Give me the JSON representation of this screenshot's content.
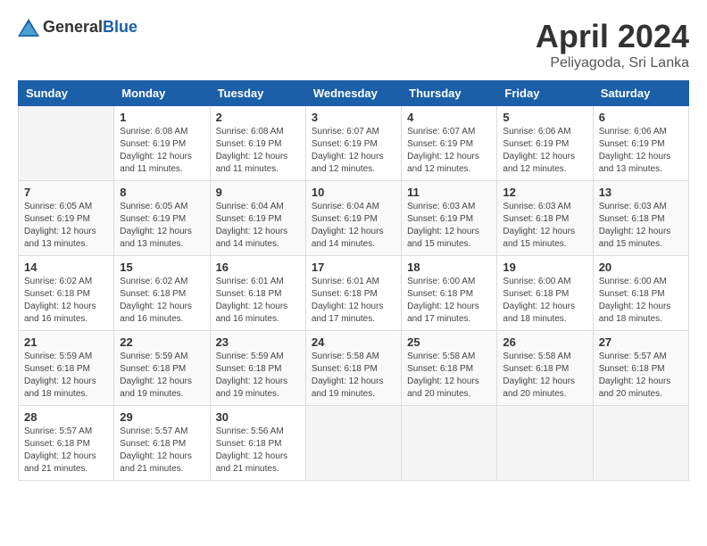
{
  "header": {
    "logo_general": "General",
    "logo_blue": "Blue",
    "month": "April 2024",
    "location": "Peliyagoda, Sri Lanka"
  },
  "weekdays": [
    "Sunday",
    "Monday",
    "Tuesday",
    "Wednesday",
    "Thursday",
    "Friday",
    "Saturday"
  ],
  "weeks": [
    [
      {
        "day": "",
        "sunrise": "",
        "sunset": "",
        "daylight": ""
      },
      {
        "day": "1",
        "sunrise": "Sunrise: 6:08 AM",
        "sunset": "Sunset: 6:19 PM",
        "daylight": "Daylight: 12 hours and 11 minutes."
      },
      {
        "day": "2",
        "sunrise": "Sunrise: 6:08 AM",
        "sunset": "Sunset: 6:19 PM",
        "daylight": "Daylight: 12 hours and 11 minutes."
      },
      {
        "day": "3",
        "sunrise": "Sunrise: 6:07 AM",
        "sunset": "Sunset: 6:19 PM",
        "daylight": "Daylight: 12 hours and 12 minutes."
      },
      {
        "day": "4",
        "sunrise": "Sunrise: 6:07 AM",
        "sunset": "Sunset: 6:19 PM",
        "daylight": "Daylight: 12 hours and 12 minutes."
      },
      {
        "day": "5",
        "sunrise": "Sunrise: 6:06 AM",
        "sunset": "Sunset: 6:19 PM",
        "daylight": "Daylight: 12 hours and 12 minutes."
      },
      {
        "day": "6",
        "sunrise": "Sunrise: 6:06 AM",
        "sunset": "Sunset: 6:19 PM",
        "daylight": "Daylight: 12 hours and 13 minutes."
      }
    ],
    [
      {
        "day": "7",
        "sunrise": "Sunrise: 6:05 AM",
        "sunset": "Sunset: 6:19 PM",
        "daylight": "Daylight: 12 hours and 13 minutes."
      },
      {
        "day": "8",
        "sunrise": "Sunrise: 6:05 AM",
        "sunset": "Sunset: 6:19 PM",
        "daylight": "Daylight: 12 hours and 13 minutes."
      },
      {
        "day": "9",
        "sunrise": "Sunrise: 6:04 AM",
        "sunset": "Sunset: 6:19 PM",
        "daylight": "Daylight: 12 hours and 14 minutes."
      },
      {
        "day": "10",
        "sunrise": "Sunrise: 6:04 AM",
        "sunset": "Sunset: 6:19 PM",
        "daylight": "Daylight: 12 hours and 14 minutes."
      },
      {
        "day": "11",
        "sunrise": "Sunrise: 6:03 AM",
        "sunset": "Sunset: 6:19 PM",
        "daylight": "Daylight: 12 hours and 15 minutes."
      },
      {
        "day": "12",
        "sunrise": "Sunrise: 6:03 AM",
        "sunset": "Sunset: 6:18 PM",
        "daylight": "Daylight: 12 hours and 15 minutes."
      },
      {
        "day": "13",
        "sunrise": "Sunrise: 6:03 AM",
        "sunset": "Sunset: 6:18 PM",
        "daylight": "Daylight: 12 hours and 15 minutes."
      }
    ],
    [
      {
        "day": "14",
        "sunrise": "Sunrise: 6:02 AM",
        "sunset": "Sunset: 6:18 PM",
        "daylight": "Daylight: 12 hours and 16 minutes."
      },
      {
        "day": "15",
        "sunrise": "Sunrise: 6:02 AM",
        "sunset": "Sunset: 6:18 PM",
        "daylight": "Daylight: 12 hours and 16 minutes."
      },
      {
        "day": "16",
        "sunrise": "Sunrise: 6:01 AM",
        "sunset": "Sunset: 6:18 PM",
        "daylight": "Daylight: 12 hours and 16 minutes."
      },
      {
        "day": "17",
        "sunrise": "Sunrise: 6:01 AM",
        "sunset": "Sunset: 6:18 PM",
        "daylight": "Daylight: 12 hours and 17 minutes."
      },
      {
        "day": "18",
        "sunrise": "Sunrise: 6:00 AM",
        "sunset": "Sunset: 6:18 PM",
        "daylight": "Daylight: 12 hours and 17 minutes."
      },
      {
        "day": "19",
        "sunrise": "Sunrise: 6:00 AM",
        "sunset": "Sunset: 6:18 PM",
        "daylight": "Daylight: 12 hours and 18 minutes."
      },
      {
        "day": "20",
        "sunrise": "Sunrise: 6:00 AM",
        "sunset": "Sunset: 6:18 PM",
        "daylight": "Daylight: 12 hours and 18 minutes."
      }
    ],
    [
      {
        "day": "21",
        "sunrise": "Sunrise: 5:59 AM",
        "sunset": "Sunset: 6:18 PM",
        "daylight": "Daylight: 12 hours and 18 minutes."
      },
      {
        "day": "22",
        "sunrise": "Sunrise: 5:59 AM",
        "sunset": "Sunset: 6:18 PM",
        "daylight": "Daylight: 12 hours and 19 minutes."
      },
      {
        "day": "23",
        "sunrise": "Sunrise: 5:59 AM",
        "sunset": "Sunset: 6:18 PM",
        "daylight": "Daylight: 12 hours and 19 minutes."
      },
      {
        "day": "24",
        "sunrise": "Sunrise: 5:58 AM",
        "sunset": "Sunset: 6:18 PM",
        "daylight": "Daylight: 12 hours and 19 minutes."
      },
      {
        "day": "25",
        "sunrise": "Sunrise: 5:58 AM",
        "sunset": "Sunset: 6:18 PM",
        "daylight": "Daylight: 12 hours and 20 minutes."
      },
      {
        "day": "26",
        "sunrise": "Sunrise: 5:58 AM",
        "sunset": "Sunset: 6:18 PM",
        "daylight": "Daylight: 12 hours and 20 minutes."
      },
      {
        "day": "27",
        "sunrise": "Sunrise: 5:57 AM",
        "sunset": "Sunset: 6:18 PM",
        "daylight": "Daylight: 12 hours and 20 minutes."
      }
    ],
    [
      {
        "day": "28",
        "sunrise": "Sunrise: 5:57 AM",
        "sunset": "Sunset: 6:18 PM",
        "daylight": "Daylight: 12 hours and 21 minutes."
      },
      {
        "day": "29",
        "sunrise": "Sunrise: 5:57 AM",
        "sunset": "Sunset: 6:18 PM",
        "daylight": "Daylight: 12 hours and 21 minutes."
      },
      {
        "day": "30",
        "sunrise": "Sunrise: 5:56 AM",
        "sunset": "Sunset: 6:18 PM",
        "daylight": "Daylight: 12 hours and 21 minutes."
      },
      {
        "day": "",
        "sunrise": "",
        "sunset": "",
        "daylight": ""
      },
      {
        "day": "",
        "sunrise": "",
        "sunset": "",
        "daylight": ""
      },
      {
        "day": "",
        "sunrise": "",
        "sunset": "",
        "daylight": ""
      },
      {
        "day": "",
        "sunrise": "",
        "sunset": "",
        "daylight": ""
      }
    ]
  ]
}
